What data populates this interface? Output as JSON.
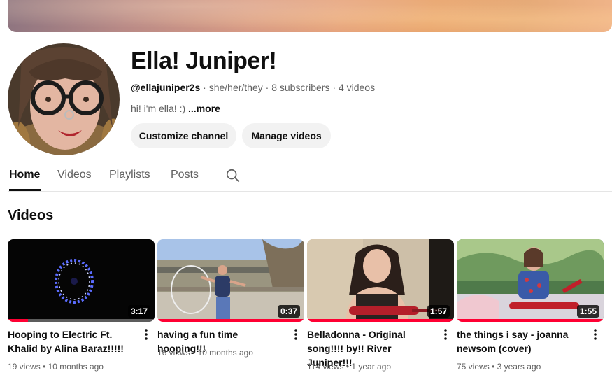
{
  "channel": {
    "name": "Ella! Juniper!",
    "handle": "@ellajuniper2s",
    "pronouns": "she/her/they",
    "subscribers": "8 subscribers",
    "video_count": "4 videos",
    "separator": "·",
    "description": "hi! i'm ella! :) ",
    "more_label": "...more"
  },
  "actions": {
    "customize": "Customize channel",
    "manage": "Manage videos"
  },
  "tabs": [
    "Home",
    "Videos",
    "Playlists",
    "Posts"
  ],
  "active_tab": "Home",
  "section_title": "Videos",
  "videos": [
    {
      "title": "Hooping to Electric Ft. Khalid by Alina Baraz!!!!!",
      "duration": "3:17",
      "views": "19 views",
      "age": "10 months ago",
      "watched_fraction": 0.14
    },
    {
      "title": "having a fun time hooping!!!",
      "duration": "0:37",
      "views": "16 views",
      "age": "10 months ago",
      "watched_fraction": 1.0
    },
    {
      "title": "Belladonna - Original song!!!! by!! River Juniper!!!",
      "duration": "1:57",
      "views": "114 views",
      "age": "1 year ago",
      "watched_fraction": 1.0
    },
    {
      "title": "the things i say - joanna newsom (cover)",
      "duration": "1:55",
      "views": "75 views",
      "age": "3 years ago",
      "watched_fraction": 1.0
    }
  ],
  "meta_separator": "•",
  "icons": {
    "search": "search-icon",
    "kebab": "more-vert-icon"
  },
  "colors": {
    "accent": "#ff0033",
    "text": "#0f0f0f",
    "secondary_text": "#606060",
    "button_bg": "#f2f2f2"
  }
}
